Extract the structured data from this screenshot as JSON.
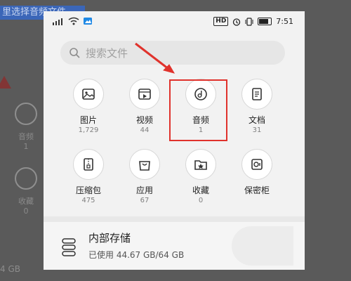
{
  "background": {
    "title_fragment": "里选择音频文件",
    "side_items": [
      {
        "label": "音频",
        "count": "1"
      },
      {
        "label": "收藏",
        "count": "0"
      }
    ],
    "bottom_text": "4 GB"
  },
  "status_bar": {
    "signal": "signal-icon",
    "wifi": "wifi-icon",
    "time": "7:51",
    "hd_badge": "HD"
  },
  "search": {
    "placeholder": "搜索文件"
  },
  "categories": [
    {
      "label": "图片",
      "count": "1,729",
      "icon": "image-icon"
    },
    {
      "label": "视频",
      "count": "44",
      "icon": "video-icon"
    },
    {
      "label": "音频",
      "count": "1",
      "icon": "audio-icon"
    },
    {
      "label": "文档",
      "count": "31",
      "icon": "document-icon"
    },
    {
      "label": "压缩包",
      "count": "475",
      "icon": "archive-icon"
    },
    {
      "label": "应用",
      "count": "67",
      "icon": "app-icon"
    },
    {
      "label": "收藏",
      "count": "0",
      "icon": "favorite-icon"
    },
    {
      "label": "保密柜",
      "count": "",
      "icon": "safe-icon"
    }
  ],
  "storage": {
    "title": "内部存储",
    "usage": "已使用 44.67 GB/64 GB"
  },
  "annotation_colors": {
    "highlight": "#e0322c",
    "arrow": "#e0322c"
  }
}
